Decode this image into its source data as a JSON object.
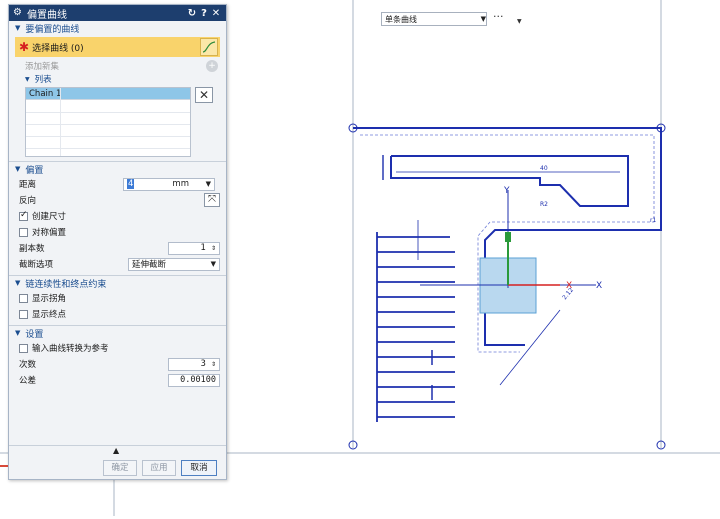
{
  "dialog": {
    "title": "偏置曲线",
    "buttons": {
      "reset": "↻",
      "help": "?",
      "close": "✕"
    },
    "sections": {
      "curves": {
        "header": "要偏置的曲线",
        "select_label": "选择曲线 (0)",
        "add_set": "添加新集",
        "list": {
          "header": "列表",
          "items": [
            "Chain 1"
          ]
        }
      },
      "offset": {
        "header": "偏置",
        "distance_label": "距离",
        "distance_value": "4",
        "distance_unit": "mm",
        "reverse_label": "反向",
        "create_dimension_label": "创建尺寸",
        "create_dimension_checked": true,
        "symmetric_label": "对称偏置",
        "symmetric_checked": false,
        "copies_label": "副本数",
        "copies_value": "1",
        "cap_label": "截断选项",
        "cap_value": "延伸截断"
      },
      "chain": {
        "header": "链连续性和终点约束",
        "show_corners": "显示拐角",
        "show_endpoints": "显示终点"
      },
      "settings": {
        "header": "设置",
        "convert_label": "输入曲线转换为参考",
        "degree_label": "次数",
        "degree_value": "3",
        "tolerance_label": "公差",
        "tolerance_value": "0.00100"
      }
    },
    "footer": {
      "ok": "确定",
      "apply": "应用",
      "cancel": "取消"
    }
  },
  "toolbar": {
    "select_value": "单条曲线",
    "more": "···"
  },
  "canvas": {
    "axis_x": "X",
    "axis_y": "Y",
    "dim_labels": [
      "40",
      "R2",
      "r1",
      "2.12"
    ]
  },
  "colors": {
    "geometry": "#1d2fae",
    "title_bar": "#1d3e6e",
    "highlight": "#f9d36b"
  }
}
